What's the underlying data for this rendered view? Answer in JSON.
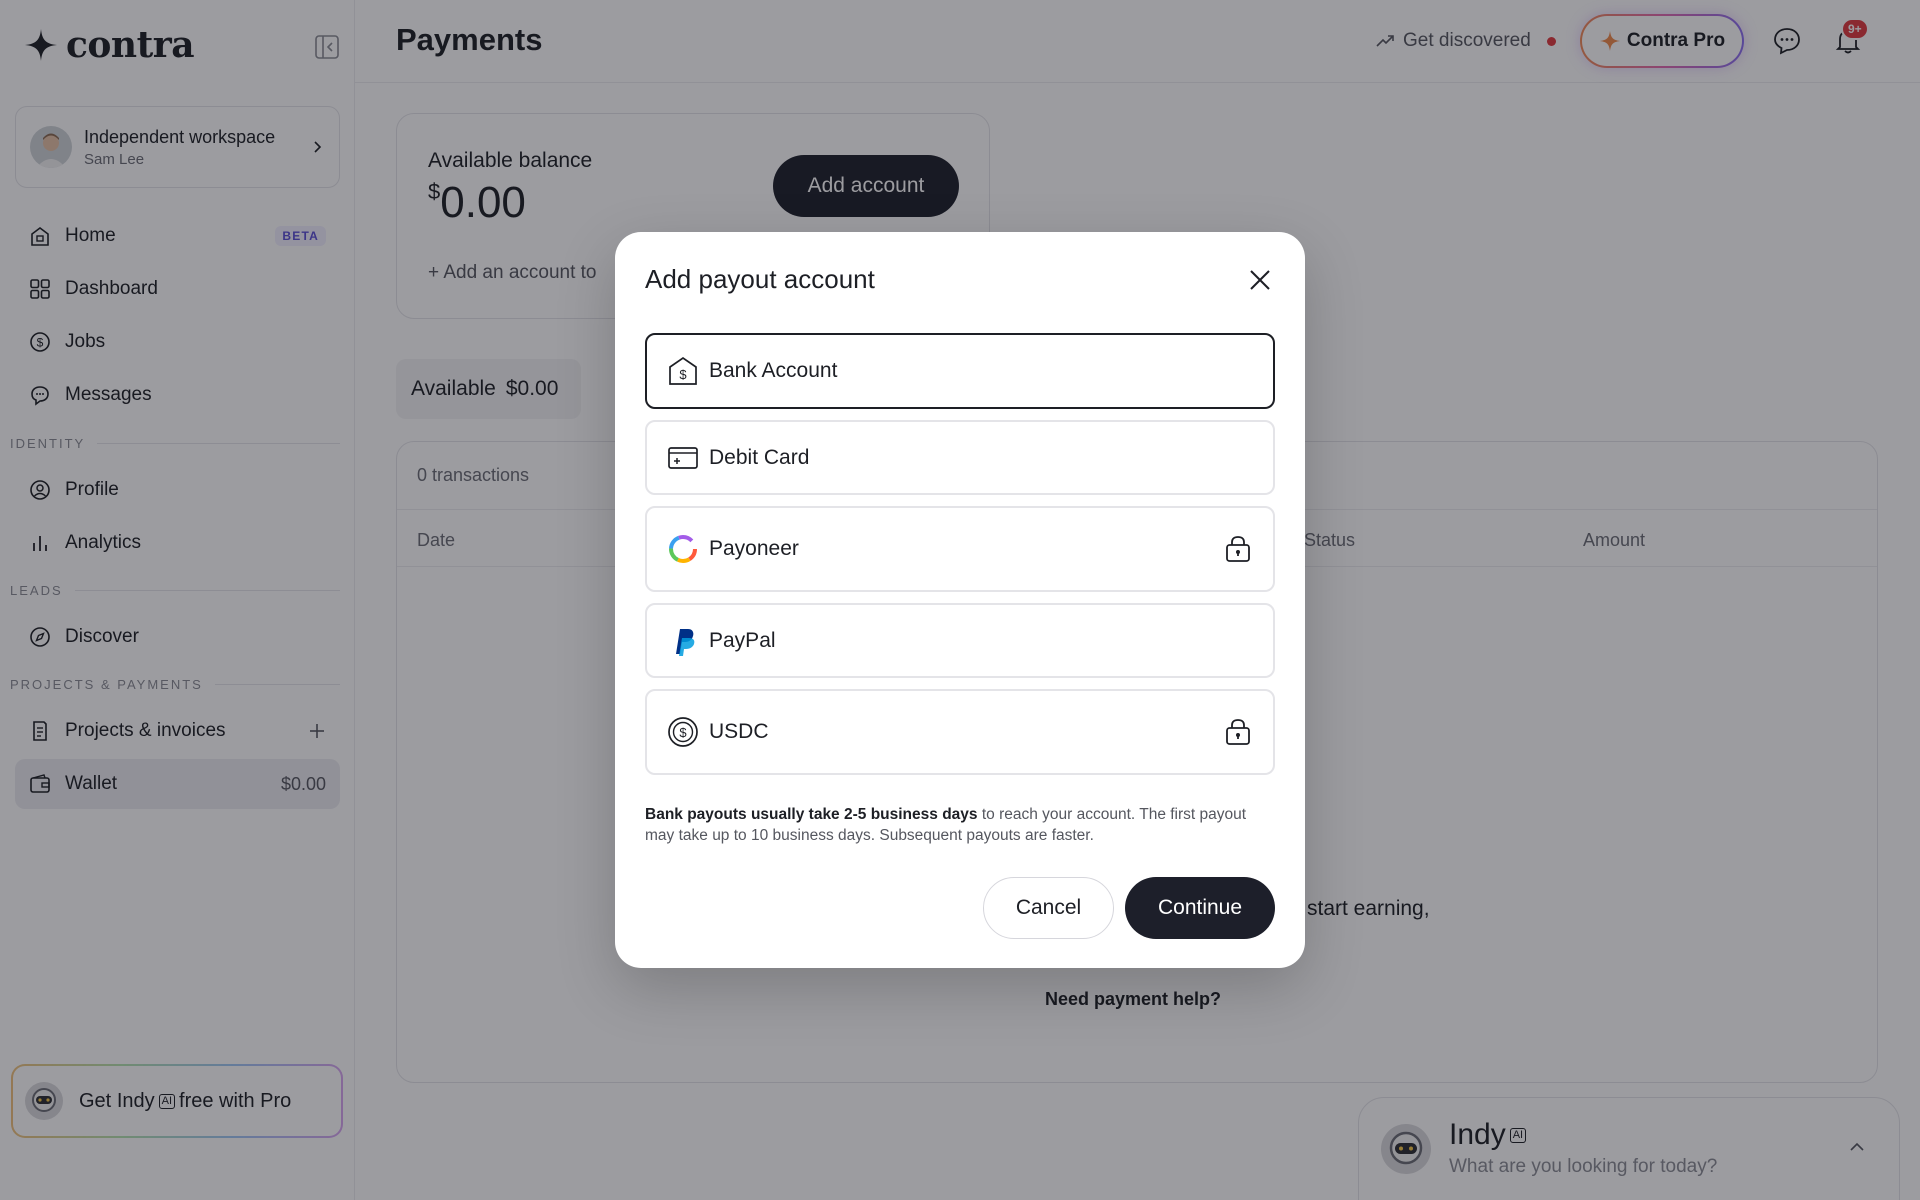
{
  "app": {
    "logo_text": "contra"
  },
  "workspace": {
    "name": "Independent workspace",
    "user": "Sam Lee"
  },
  "sidebar": {
    "items": [
      {
        "label": "Home",
        "badge": "BETA",
        "icon": "home-icon"
      },
      {
        "label": "Dashboard",
        "icon": "dashboard-icon"
      },
      {
        "label": "Jobs",
        "icon": "dollar-circle-icon"
      },
      {
        "label": "Messages",
        "icon": "message-icon"
      }
    ],
    "sections": {
      "identity": "IDENTITY",
      "leads": "LEADS",
      "projects": "PROJECTS & PAYMENTS"
    },
    "identity_items": [
      {
        "label": "Profile",
        "icon": "profile-icon"
      },
      {
        "label": "Analytics",
        "icon": "analytics-icon"
      }
    ],
    "leads_items": [
      {
        "label": "Discover",
        "icon": "compass-icon"
      }
    ],
    "projects_items": [
      {
        "label": "Projects & invoices",
        "icon": "invoice-icon"
      },
      {
        "label": "Wallet",
        "amount": "$0.00",
        "icon": "wallet-icon"
      }
    ],
    "promo": {
      "pre": "Get",
      "name": "Indy",
      "ai": "AI",
      "post": "free with Pro"
    }
  },
  "header": {
    "title": "Payments",
    "get_discovered": "Get discovered",
    "pro_button": "Contra Pro",
    "notification_count": "9+"
  },
  "balance": {
    "label": "Available balance",
    "currency": "$",
    "amount": "0.00",
    "add_account_button": "Add account",
    "add_account_line": "Add an account to"
  },
  "available_tab": {
    "label": "Available",
    "amount": "$0.00"
  },
  "transactions": {
    "count": "0 transactions",
    "columns": {
      "date": "Date",
      "status": "Status",
      "amount": "Amount"
    },
    "empty_partial": "start earning,",
    "help": "Need payment help?"
  },
  "indy_chat": {
    "title": "Indy",
    "ai": "AI",
    "placeholder": "What are you looking for today?"
  },
  "modal": {
    "title": "Add payout account",
    "options": [
      {
        "label": "Bank Account",
        "icon": "bank-icon",
        "selected": true,
        "locked": false
      },
      {
        "label": "Debit Card",
        "icon": "card-icon",
        "selected": false,
        "locked": false
      },
      {
        "label": "Payoneer",
        "icon": "payoneer-icon",
        "selected": false,
        "locked": true
      },
      {
        "label": "PayPal",
        "icon": "paypal-icon",
        "selected": false,
        "locked": false
      },
      {
        "label": "USDC",
        "icon": "usdc-icon",
        "selected": false,
        "locked": true
      }
    ],
    "note_bold": "Bank payouts usually take 2-5 business days",
    "note_rest": " to reach your account. The first payout may take up to 10 business days. Subsequent payouts are faster.",
    "cancel": "Cancel",
    "continue": "Continue"
  },
  "colors": {
    "primary_dark": "#1d1f2a",
    "notification_red": "#e0393e",
    "beta_purple": "#5b4fd6"
  }
}
